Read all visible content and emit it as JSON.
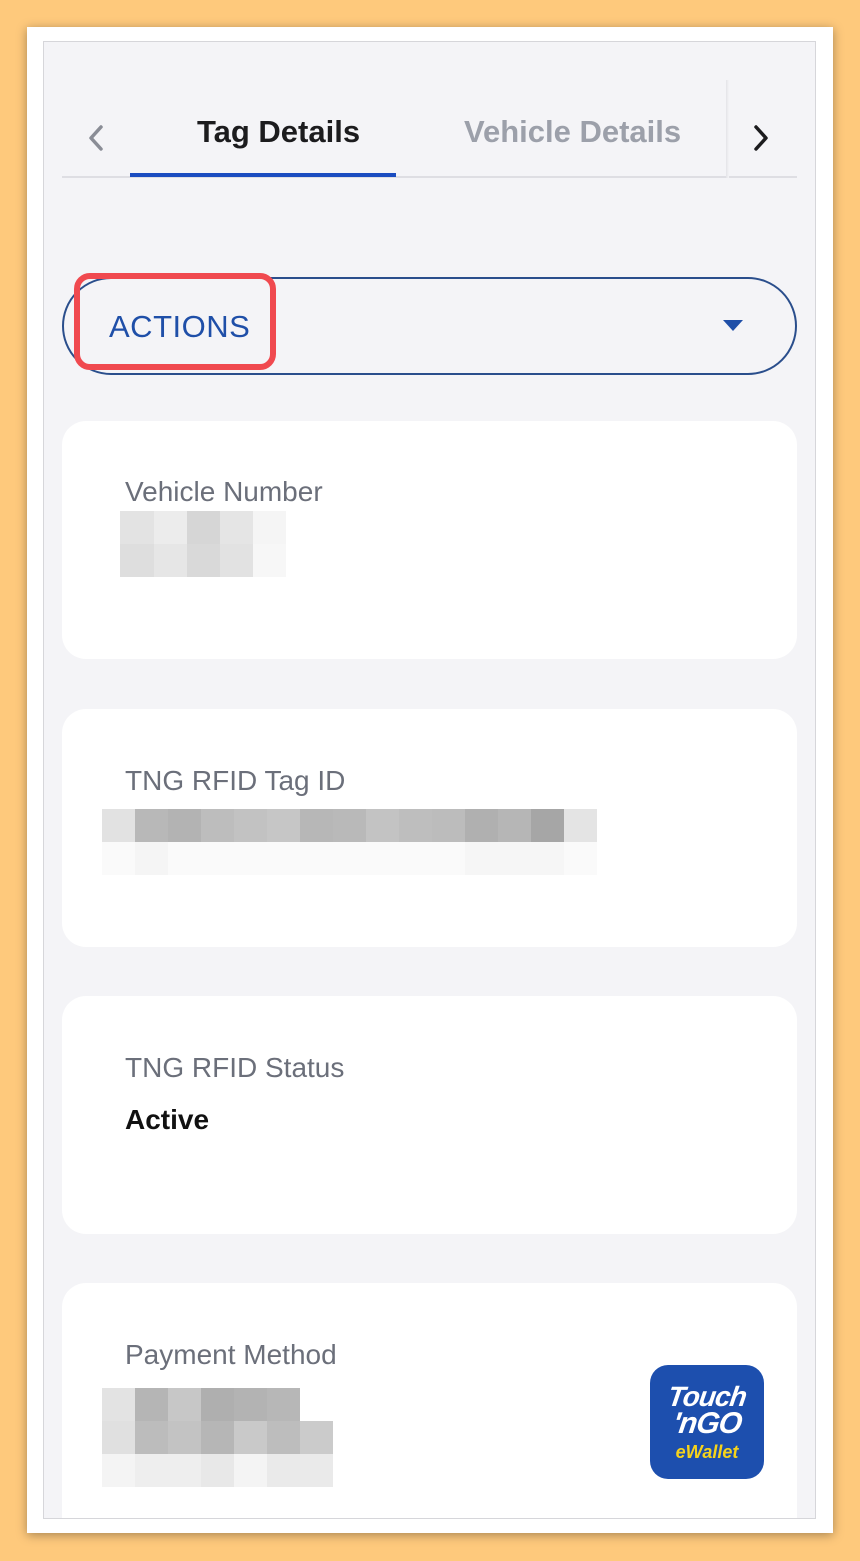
{
  "tabs": {
    "prev_icon": "chevron-left-icon",
    "next_icon": "chevron-right-icon",
    "items": [
      {
        "label": "Tag Details",
        "active": true
      },
      {
        "label": "Vehicle Details",
        "active": false
      }
    ]
  },
  "actions": {
    "label": "ACTIONS",
    "caret_icon": "caret-down-icon"
  },
  "cards": {
    "vehicle_number": {
      "label": "Vehicle Number",
      "value": "[redacted]"
    },
    "tag_id": {
      "label": "TNG RFID Tag ID",
      "value": "[redacted]"
    },
    "status": {
      "label": "TNG RFID Status",
      "value": "Active"
    },
    "payment": {
      "label": "Payment Method",
      "value": "[redacted]",
      "logo": {
        "line1": "Touch",
        "line2": "'nGO",
        "line3": "eWallet"
      }
    }
  },
  "colors": {
    "accent": "#1a4cc0",
    "highlight": "#f0494f",
    "page_bg": "#f4f4f7",
    "outer_bg": "#fec97c",
    "logo_blue": "#1d4fae",
    "logo_yellow": "#f6d31b"
  }
}
